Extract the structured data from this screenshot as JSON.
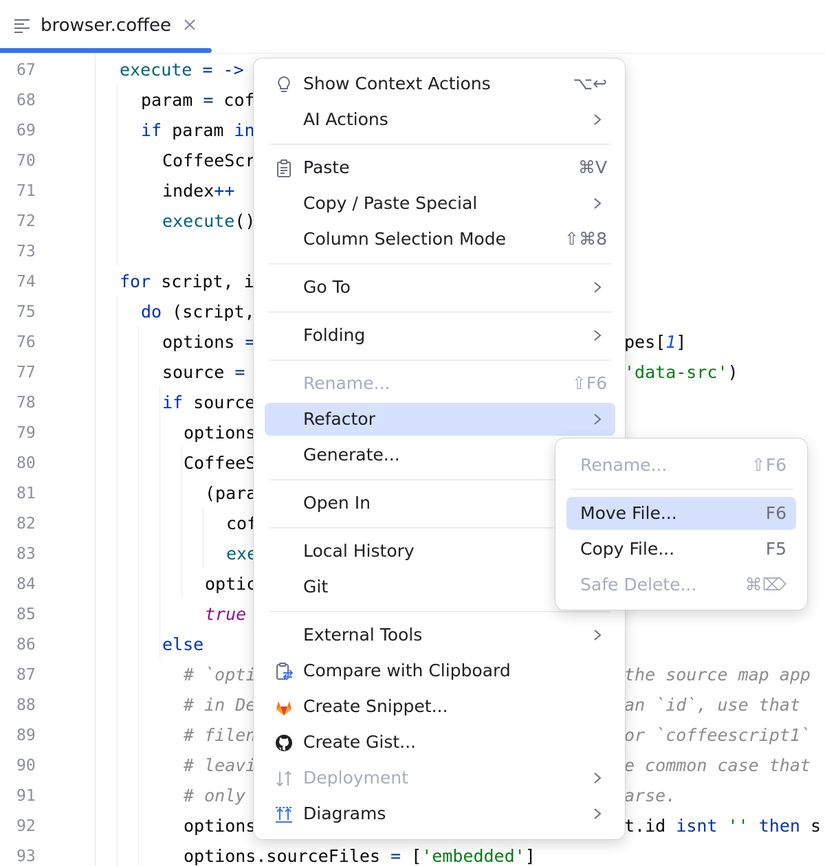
{
  "tab": {
    "title": "browser.coffee"
  },
  "editor": {
    "line_numbers": [
      "67",
      "68",
      "69",
      "70",
      "71",
      "72",
      "73",
      "74",
      "75",
      "76",
      "77",
      "78",
      "79",
      "80",
      "81",
      "82",
      "83",
      "84",
      "85",
      "86",
      "87",
      "88",
      "89",
      "90",
      "91",
      "92",
      "93"
    ],
    "lines": [
      [
        {
          "t": "execute",
          "c": "fn"
        },
        {
          "t": " = ",
          "c": "op"
        },
        {
          "t": "->",
          "c": "op"
        }
      ],
      [
        {
          "t": "param",
          "c": ""
        },
        {
          "t": " = ",
          "c": "op"
        },
        {
          "t": "cof",
          "c": ""
        }
      ],
      [
        {
          "t": "if",
          "c": "kw"
        },
        {
          "t": " param ",
          "c": ""
        },
        {
          "t": "in",
          "c": "kw"
        }
      ],
      [
        {
          "t": "CoffeeScr",
          "c": ""
        }
      ],
      [
        {
          "t": "index",
          "c": ""
        },
        {
          "t": "++",
          "c": "op"
        }
      ],
      [
        {
          "t": "execute",
          "c": "fn"
        },
        {
          "t": "()",
          "c": ""
        }
      ],
      [],
      [
        {
          "t": "for",
          "c": "kw"
        },
        {
          "t": " script, i",
          "c": ""
        }
      ],
      [
        {
          "t": "do",
          "c": "kw"
        },
        {
          "t": " (script,",
          "c": ""
        }
      ],
      [
        {
          "t": "options ",
          "c": ""
        },
        {
          "t": "=",
          "c": "op"
        }
      ],
      [
        {
          "t": "source ",
          "c": ""
        },
        {
          "t": "=",
          "c": "op"
        }
      ],
      [
        {
          "t": "if",
          "c": "kw"
        },
        {
          "t": " source",
          "c": ""
        }
      ],
      [
        {
          "t": "options",
          "c": ""
        }
      ],
      [
        {
          "t": "CoffeeS",
          "c": ""
        }
      ],
      [
        {
          "t": "(para",
          "c": ""
        }
      ],
      [
        {
          "t": "cof",
          "c": ""
        }
      ],
      [
        {
          "t": "exe",
          "c": "fn"
        }
      ],
      [
        {
          "t": "optic",
          "c": ""
        }
      ],
      [
        {
          "t": "true",
          "c": "bool"
        }
      ],
      [
        {
          "t": "else",
          "c": "kw"
        }
      ],
      [
        {
          "t": "# `opti",
          "c": "cmt"
        }
      ],
      [
        {
          "t": "# in De",
          "c": "cmt"
        }
      ],
      [
        {
          "t": "# filen",
          "c": "cmt"
        }
      ],
      [
        {
          "t": "# leavi",
          "c": "cmt"
        }
      ],
      [
        {
          "t": "# only ",
          "c": "cmt"
        }
      ],
      [
        {
          "t": "options",
          "c": ""
        }
      ],
      [
        {
          "t": "options.sourceFiles ",
          "c": ""
        },
        {
          "t": "= ",
          "c": "op"
        },
        {
          "t": "[",
          "c": ""
        },
        {
          "t": "'embedded'",
          "c": "str"
        },
        {
          "t": "]",
          "c": ""
        }
      ]
    ],
    "right_fragments": [
      {
        "line": 9,
        "parts": [
          {
            "t": "pes[",
            "c": ""
          },
          {
            "t": "1",
            "c": "num"
          },
          {
            "t": "]",
            "c": ""
          }
        ]
      },
      {
        "line": 10,
        "parts": [
          {
            "t": "'data-src'",
            "c": "str"
          },
          {
            "t": ")",
            "c": ""
          }
        ]
      },
      {
        "line": 20,
        "parts": [
          {
            "t": "the source map app",
            "c": "cmt"
          }
        ]
      },
      {
        "line": 21,
        "parts": [
          {
            "t": "an `id`, use that",
            "c": "cmt"
          }
        ]
      },
      {
        "line": 22,
        "parts": [
          {
            "t": "or `coffeescript1`",
            "c": "cmt"
          }
        ]
      },
      {
        "line": 23,
        "parts": [
          {
            "t": "e common case that",
            "c": "cmt"
          }
        ]
      },
      {
        "line": 24,
        "parts": [
          {
            "t": "arse.",
            "c": "cmt"
          }
        ]
      },
      {
        "line": 25,
        "parts": [
          {
            "t": "t.id ",
            "c": ""
          },
          {
            "t": "isnt",
            "c": "kw"
          },
          {
            "t": " ",
            "c": ""
          },
          {
            "t": "''",
            "c": "str"
          },
          {
            "t": " ",
            "c": ""
          },
          {
            "t": "then",
            "c": "kw"
          },
          {
            "t": " s",
            "c": ""
          }
        ]
      }
    ]
  },
  "context_menu": {
    "items": [
      {
        "label": "Show Context Actions",
        "shortcut": "⌥↩",
        "icon": "lightbulb-icon"
      },
      {
        "label": "AI Actions",
        "submenu": true
      },
      {
        "label": "Paste",
        "shortcut": "⌘V",
        "icon": "clipboard-icon"
      },
      {
        "label": "Copy / Paste Special",
        "submenu": true
      },
      {
        "label": "Column Selection Mode",
        "shortcut": "⇧⌘8"
      },
      {
        "label": "Go To",
        "submenu": true
      },
      {
        "label": "Folding",
        "submenu": true
      },
      {
        "label": "Rename...",
        "shortcut": "⇧F6",
        "disabled": true
      },
      {
        "label": "Refactor",
        "submenu": true,
        "selected": true
      },
      {
        "label": "Generate..."
      },
      {
        "label": "Open In"
      },
      {
        "label": "Local History"
      },
      {
        "label": "Git"
      },
      {
        "label": "External Tools",
        "submenu": true
      },
      {
        "label": "Compare with Clipboard",
        "icon": "compare-clipboard-icon"
      },
      {
        "label": "Create Snippet...",
        "icon": "gitlab-icon"
      },
      {
        "label": "Create Gist...",
        "icon": "github-icon"
      },
      {
        "label": "Deployment",
        "submenu": true,
        "disabled": true,
        "icon": "deployment-icon"
      },
      {
        "label": "Diagrams",
        "submenu": true,
        "icon": "diagrams-icon"
      }
    ]
  },
  "refactor_submenu": {
    "items": [
      {
        "label": "Rename...",
        "shortcut": "⇧F6",
        "disabled": true
      },
      {
        "label": "Move File...",
        "shortcut": "F6",
        "selected": true
      },
      {
        "label": "Copy File...",
        "shortcut": "F5"
      },
      {
        "label": "Safe Delete...",
        "shortcut": "⌘⌦",
        "disabled": true
      }
    ]
  },
  "colors": {
    "accent": "#3574f0",
    "selection": "#d5e1fd",
    "gitlab_orange": "#fc6d26",
    "github_black": "#1e1f22"
  }
}
